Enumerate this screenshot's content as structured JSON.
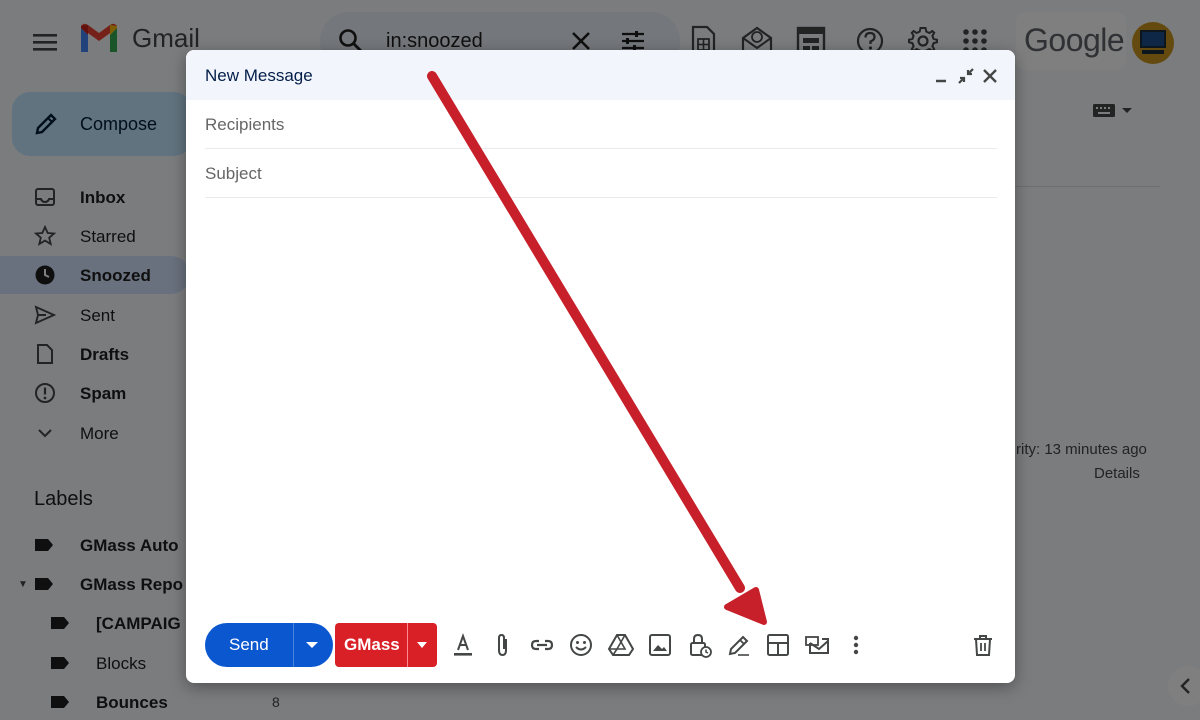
{
  "app": {
    "name": "Gmail",
    "brand_word": "Google"
  },
  "search": {
    "query": "in:snoozed"
  },
  "sidebar": {
    "compose_label": "Compose",
    "items": [
      {
        "label": "Inbox",
        "bold": true
      },
      {
        "label": "Starred",
        "bold": false
      },
      {
        "label": "Snoozed",
        "bold": true,
        "active": true
      },
      {
        "label": "Sent",
        "bold": false
      },
      {
        "label": "Drafts",
        "bold": true
      },
      {
        "label": "Spam",
        "bold": true
      },
      {
        "label": "More",
        "bold": false
      }
    ],
    "labels_heading": "Labels",
    "labels": [
      {
        "label": "GMass Auto"
      },
      {
        "label": "GMass Repo"
      },
      {
        "label": "[CAMPAIG"
      },
      {
        "label": "Blocks"
      },
      {
        "label": "Bounces",
        "count": "8"
      }
    ]
  },
  "main": {
    "activity_text": "rity: 13 minutes ago",
    "details_label": "Details"
  },
  "compose": {
    "title": "New Message",
    "recipients_placeholder": "Recipients",
    "subject_placeholder": "Subject",
    "send_label": "Send",
    "gmass_label": "GMass"
  },
  "colors": {
    "send_blue": "#0b57d0",
    "gmass_red": "#d92027",
    "annotation_arrow": "#c8202a",
    "compose_header": "#f2f6fc",
    "snoozed_highlight": "#d3e3fd"
  }
}
